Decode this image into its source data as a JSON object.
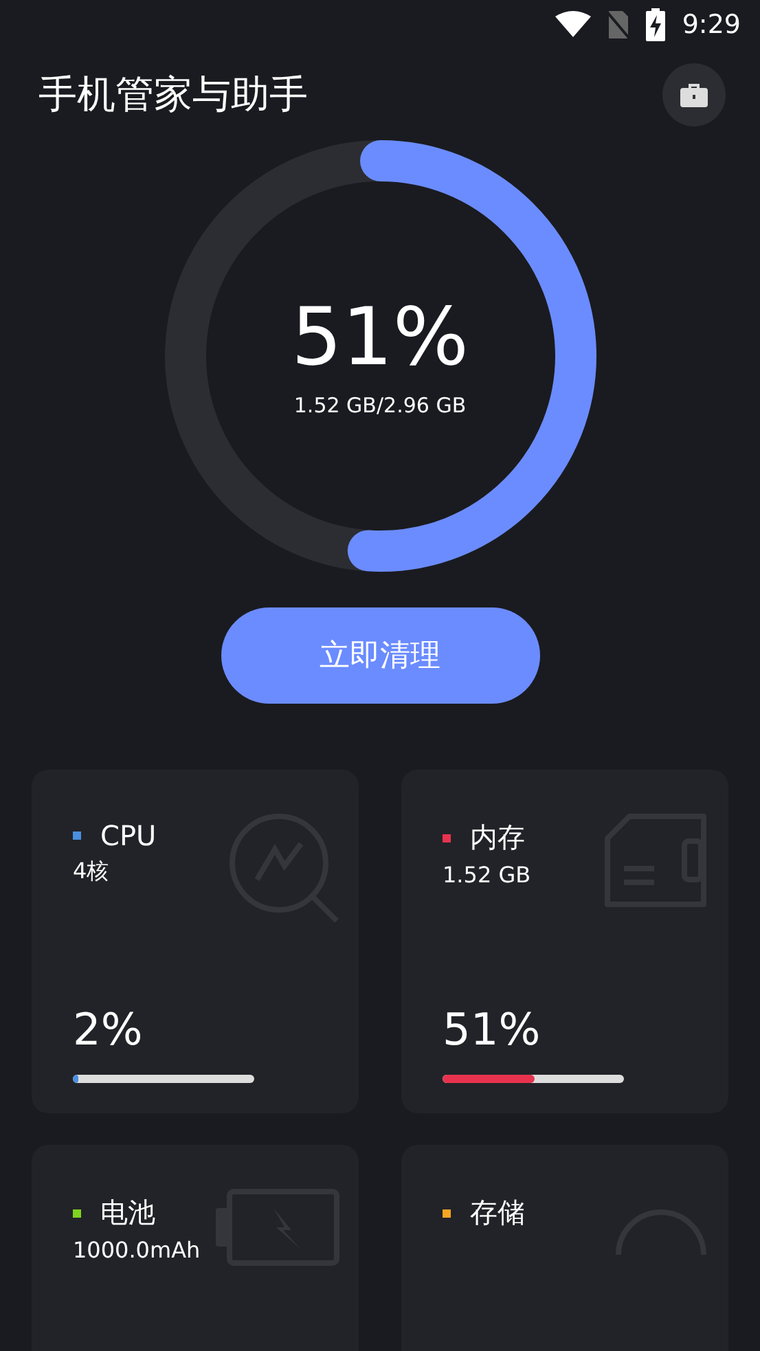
{
  "status_bar": {
    "time": "9:29"
  },
  "header": {
    "title": "手机管家与助手"
  },
  "gauge": {
    "level": 0.51,
    "percent": "51%",
    "detail": "1.52 GB/2.96 GB"
  },
  "clean_button": {
    "label": "立即清理"
  },
  "cards": [
    {
      "kind": "cpu",
      "title": "CPU",
      "color": "#4a8fe0",
      "value": "4核",
      "percent": "2%",
      "level": 0.02
    },
    {
      "kind": "memory",
      "title": "内存",
      "color": "#e8334f",
      "value": "1.52 GB",
      "percent": "51%",
      "level": 0.51
    },
    {
      "kind": "battery",
      "title": "电池",
      "color": "#7ed321",
      "value": "1000.0mAh"
    },
    {
      "kind": "storage",
      "title": "存储",
      "color": "#f5a623"
    }
  ]
}
